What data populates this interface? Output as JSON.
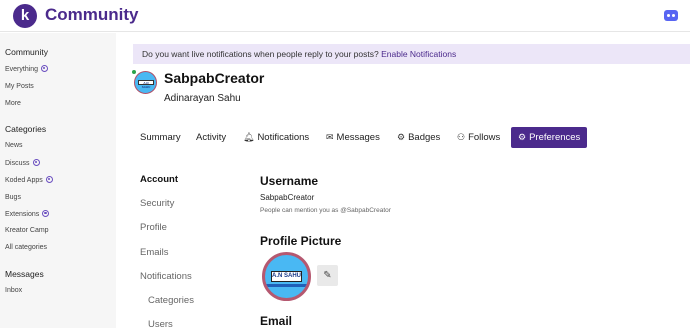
{
  "header": {
    "logo_letter": "k",
    "title": "Community"
  },
  "sidebar": {
    "sections": [
      {
        "heading": "Community",
        "items": [
          {
            "label": "Everything",
            "dot": true
          },
          {
            "label": "My Posts",
            "dot": false
          },
          {
            "label": "More",
            "dot": false
          }
        ]
      },
      {
        "heading": "Categories",
        "items": [
          {
            "label": "News",
            "dot": false
          },
          {
            "label": "Discuss",
            "dot": true
          },
          {
            "label": "Koded Apps",
            "dot": true
          },
          {
            "label": "Bugs",
            "dot": false
          },
          {
            "label": "Extensions",
            "dot": true
          },
          {
            "label": "Kreator Camp",
            "dot": false
          },
          {
            "label": "All categories",
            "dot": false
          }
        ]
      },
      {
        "heading": "Messages",
        "items": [
          {
            "label": "Inbox",
            "dot": false
          }
        ]
      }
    ]
  },
  "notice": {
    "text": "Do you want live notifications when people reply to your posts?",
    "link": "Enable Notifications"
  },
  "profile": {
    "avatar_label": "A.N SAHU",
    "username": "SabpabCreator",
    "full_name": "Adinarayan Sahu"
  },
  "tabs": [
    {
      "label": "Summary",
      "icon": ""
    },
    {
      "label": "Activity",
      "icon": ""
    },
    {
      "label": "Notifications",
      "icon": "bell-icon"
    },
    {
      "label": "Messages",
      "icon": "envelope-icon"
    },
    {
      "label": "Badges",
      "icon": "certificate-icon"
    },
    {
      "label": "Follows",
      "icon": "users-icon"
    },
    {
      "label": "Preferences",
      "icon": "gear-icon"
    }
  ],
  "preferences_nav": [
    "Account",
    "Security",
    "Profile",
    "Emails",
    "Notifications",
    "Categories",
    "Users"
  ],
  "account": {
    "username_title": "Username",
    "username_value": "SabpabCreator",
    "username_hint": "People can mention you as @SabpabCreator",
    "picture_title": "Profile Picture",
    "picture_label": "A.N SAHU",
    "email_title": "Email"
  },
  "colors": {
    "brand": "#4b2a8c",
    "notice_bg": "#ece6f8",
    "sidebar_bg": "#f6f6f6"
  }
}
